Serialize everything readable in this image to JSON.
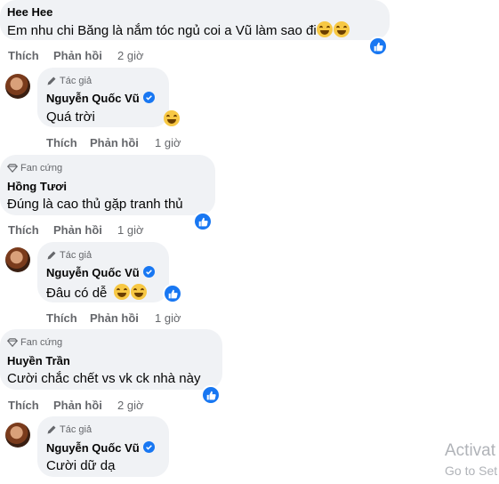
{
  "labels": {
    "like": "Thích",
    "reply": "Phản hồi"
  },
  "comments": [
    {
      "author": "Hee Hee",
      "badge": "",
      "text": "Em nhu chi Băng là nắm tóc ngủ coi a Vũ làm sao đi",
      "time": "2 giờ",
      "is_reply": false
    },
    {
      "author": "Nguyễn Quốc Vũ",
      "badge": "Tác giả",
      "text": "Quá trời",
      "time": "1 giờ",
      "is_reply": true
    },
    {
      "author": "Hồng Tươi",
      "badge": "Fan cứng",
      "text": "Đúng là cao thủ gặp tranh thủ",
      "time": "1 giờ",
      "is_reply": false
    },
    {
      "author": "Nguyễn Quốc Vũ",
      "badge": "Tác giả",
      "text": "Đâu có dễ",
      "time": "1 giờ",
      "is_reply": true
    },
    {
      "author": "Huyền Trần",
      "badge": "Fan cứng",
      "text": "Cười chắc chết vs vk ck nhà này",
      "time": "2 giờ",
      "is_reply": false
    },
    {
      "author": "Nguyễn Quốc Vũ",
      "badge": "Tác giả",
      "text": "Cười dữ dạ",
      "time": "",
      "is_reply": true
    }
  ],
  "watermark": {
    "line1": "Activat",
    "line2": "Go to Set"
  },
  "colors": {
    "bubble": "#f0f2f5",
    "like_blue": "#1877f2",
    "meta_gray": "#65676b"
  }
}
